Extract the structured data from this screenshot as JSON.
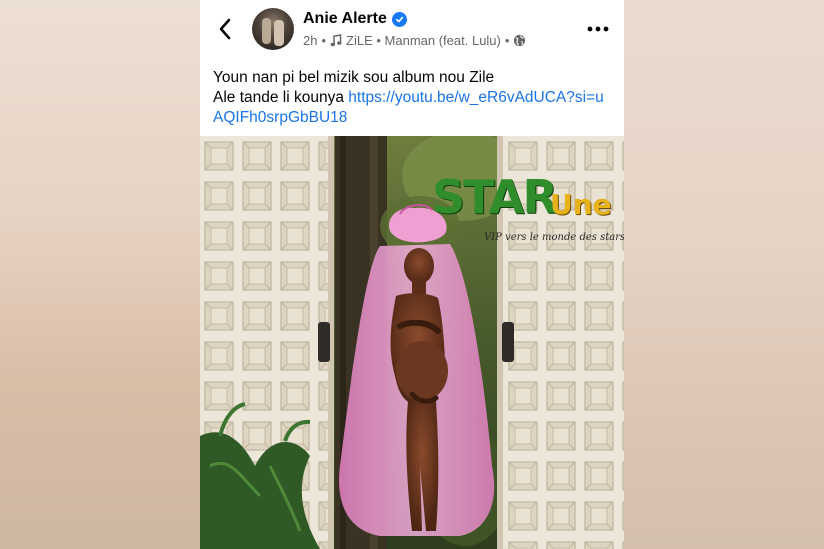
{
  "post": {
    "author": "Anie Alerte",
    "time": "2h",
    "separator": "•",
    "music": "ZiLE • Manman (feat. Lulu)",
    "separator2": "•",
    "caption_line1": "Youn nan pi bel mizik sou album nou Zile",
    "caption_line2_prefix": "Ale tande li kounya ",
    "caption_link": "https://youtu.be/w_eR6vAdUCA?si=uAQIFh0srpGbBU18"
  },
  "watermark": {
    "brand_star": "STAR",
    "brand_une": "Une",
    "tagline": "VIP vers le monde des stars"
  },
  "icons": {
    "back": "chevron-left-icon",
    "verified": "verified-badge-icon",
    "music": "music-note-icon",
    "audience": "globe-icon",
    "more": "more-horizontal-icon"
  },
  "colors": {
    "link": "#1a73e8",
    "verified": "#1877f2",
    "meta": "#65676b",
    "veil": "#e58bc6"
  }
}
